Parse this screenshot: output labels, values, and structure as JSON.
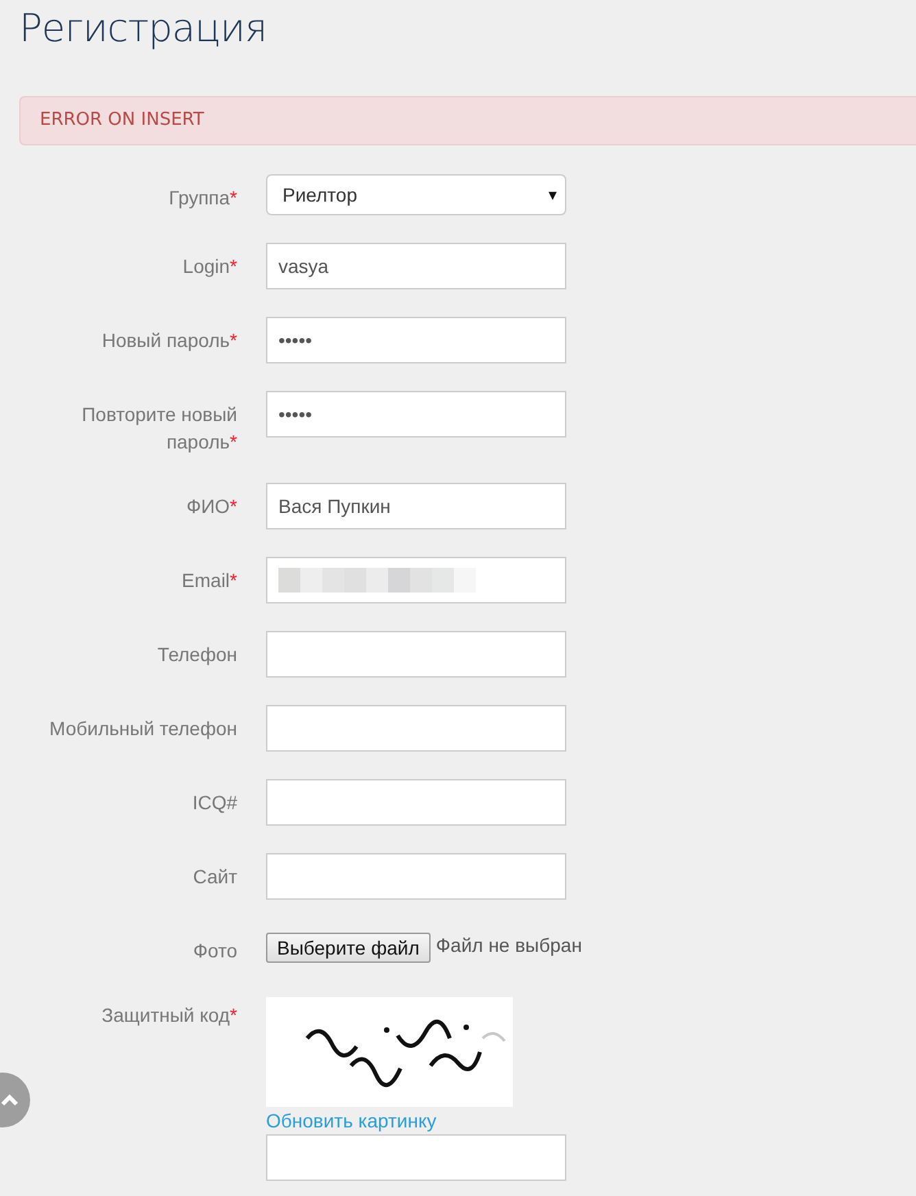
{
  "page": {
    "title": "Регистрация"
  },
  "alert": {
    "text": "ERROR ON INSERT"
  },
  "fields": [
    {
      "kind": "select",
      "label": "Группа",
      "required_mark": "*",
      "value": "Риелтор",
      "caret": "▾"
    },
    {
      "kind": "text",
      "label": "Login",
      "required_mark": "*",
      "value": "vasya"
    },
    {
      "kind": "text",
      "label": "Новый пароль",
      "required_mark": "*",
      "value": "•••••"
    },
    {
      "kind": "text",
      "label": "Повторите новый пароль",
      "required_mark": "*",
      "value": "•••••"
    },
    {
      "kind": "text",
      "label": "ФИО",
      "required_mark": "*",
      "value": "Вася Пупкин"
    },
    {
      "kind": "text",
      "label": "Email",
      "required_mark": "*",
      "blurred": true
    },
    {
      "kind": "text",
      "label": "Телефон"
    },
    {
      "kind": "text",
      "label": "Мобильный телефон"
    },
    {
      "kind": "text",
      "label": "ICQ#"
    },
    {
      "kind": "text",
      "label": "Сайт"
    },
    {
      "kind": "file",
      "label": "Фото",
      "button": "Выберите файл",
      "status": "Файл не выбран"
    },
    {
      "kind": "captcha",
      "label": "Защитный код",
      "required_mark": "*",
      "link": "Обновить картинку"
    }
  ]
}
